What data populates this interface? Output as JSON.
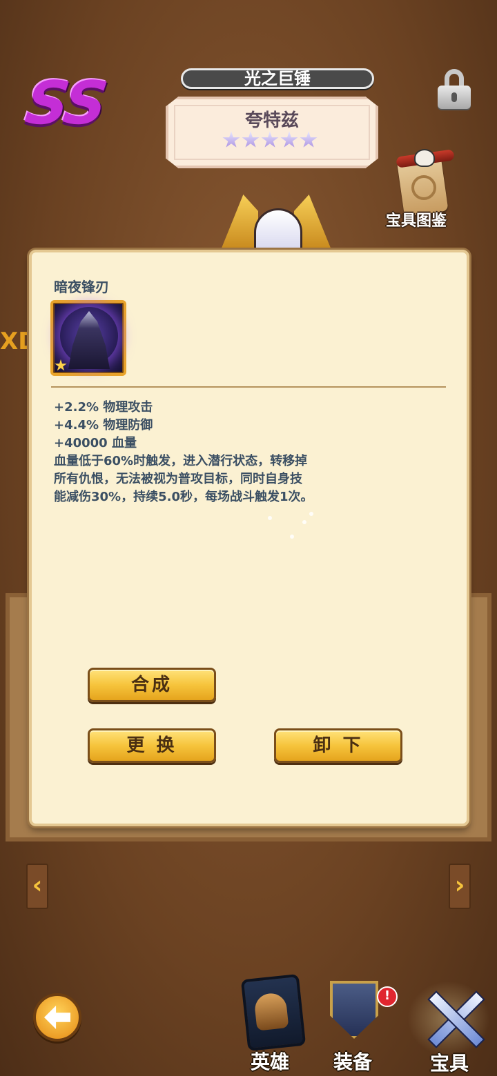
{
  "header": {
    "rank": "SS",
    "title": "光之巨锤",
    "hero_name": "夸特兹",
    "hero_stars": 5,
    "collection_label": "宝具图鉴"
  },
  "edge_text": "XD",
  "item": {
    "name": "暗夜锋刃",
    "star_level": 1,
    "stats": [
      "+2.2% 物理攻击",
      "+4.4% 物理防御",
      "+40000 血量",
      "血量低于60%时触发，进入潜行状态，转移掉",
      "所有仇恨，无法被视为普攻目标，同时自身技",
      "能减伤30%，持续5.0秒，每场战斗触发1次。"
    ]
  },
  "buttons": {
    "compose": "合成",
    "replace": "更 换",
    "unequip": "卸 下"
  },
  "arrows": {
    "left": "‹",
    "right": "›"
  },
  "nav": {
    "hero": "英雄",
    "equipment": "装备",
    "treasure": "宝具",
    "equipment_alert": "!",
    "active": "treasure"
  },
  "colors": {
    "rank": "#c42ed6",
    "panel_bg": "#fbf1d2",
    "button_gold": "#f6c43c",
    "stat_text": "#3b4f63"
  }
}
